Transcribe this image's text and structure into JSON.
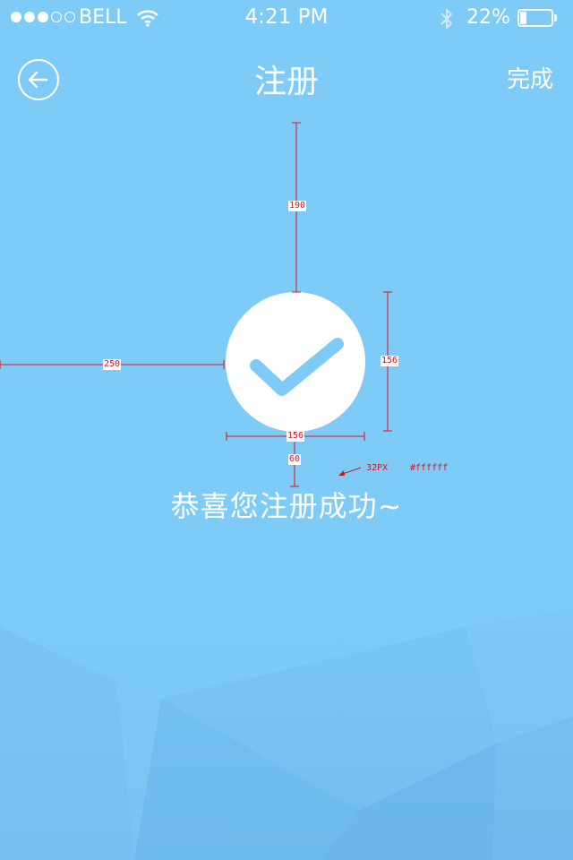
{
  "status_bar": {
    "carrier": "BELL",
    "time": "4:21 PM",
    "battery_percent": "22%",
    "battery_level": 0.22,
    "signal_bars_filled": 3,
    "signal_bars_total": 5
  },
  "nav": {
    "title": "注册",
    "done_label": "完成"
  },
  "main": {
    "success_message": "恭喜您注册成功~"
  },
  "annotations": {
    "top_spacing": "190",
    "left_spacing": "250",
    "circle_height": "156",
    "circle_width": "156",
    "text_gap": "60",
    "font_size_note": "32PX",
    "color_note": "#ffffff"
  },
  "colors": {
    "background": "#7ecbf8",
    "check_mark": "#7ecbf8",
    "foreground": "#ffffff",
    "annotation": "#d8141e"
  }
}
